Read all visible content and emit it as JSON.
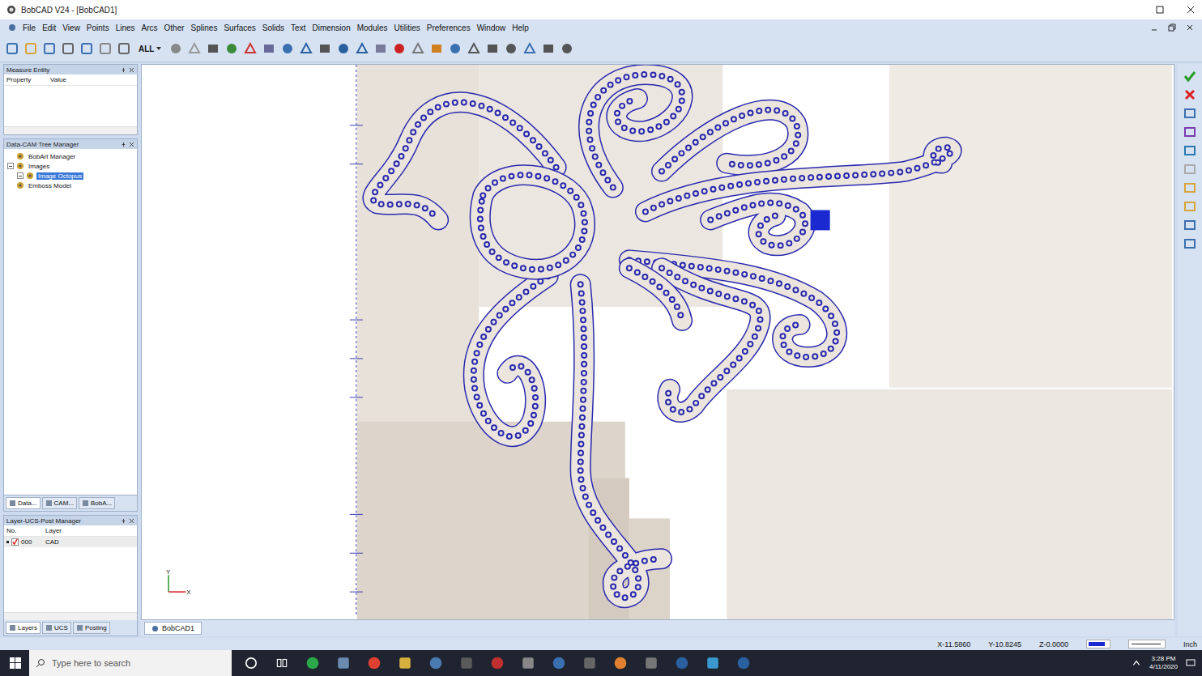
{
  "window": {
    "title": "BobCAD V24 - [BobCAD1]"
  },
  "menu": [
    "File",
    "Edit",
    "View",
    "Points",
    "Lines",
    "Arcs",
    "Other",
    "Splines",
    "Surfaces",
    "Solids",
    "Text",
    "Dimension",
    "Modules",
    "Utilities",
    "Preferences",
    "Window",
    "Help"
  ],
  "toolbar": {
    "filter": "ALL"
  },
  "measure_panel": {
    "title": "Measure Entity",
    "columns": [
      "Property",
      "Value"
    ]
  },
  "tree_panel": {
    "title": "Data-CAM Tree Manager",
    "items": [
      {
        "label": "BobArt Manager",
        "depth": 0,
        "selected": false,
        "expandable": false,
        "expanded": false
      },
      {
        "label": "Images",
        "depth": 0,
        "selected": false,
        "expandable": true,
        "expanded": true
      },
      {
        "label": "Image Octopus",
        "depth": 1,
        "selected": true,
        "expandable": true,
        "expanded": false
      },
      {
        "label": "Emboss Model",
        "depth": 0,
        "selected": false,
        "expandable": false,
        "expanded": false
      }
    ],
    "tabs": [
      {
        "label": "Data...",
        "selected": true
      },
      {
        "label": "CAM...",
        "selected": false
      },
      {
        "label": "BobA...",
        "selected": false
      }
    ]
  },
  "layer_panel": {
    "title": "Layer-UCS-Post Manager",
    "columns": [
      "No.",
      "Layer"
    ],
    "rows": [
      {
        "no": "000",
        "layer": "CAD",
        "checked": true
      }
    ],
    "tabs": [
      {
        "label": "Layers",
        "selected": true
      },
      {
        "label": "UCS",
        "selected": false
      },
      {
        "label": "Posting",
        "selected": false
      }
    ]
  },
  "axis": {
    "x": "X",
    "y": "Y"
  },
  "document_tabs": [
    {
      "label": "BobCAD1",
      "selected": true
    }
  ],
  "status_bar": {
    "x": "X-11.5860",
    "y": "Y-10.8245",
    "z": "Z-0.0000",
    "units": "Inch"
  },
  "taskbar": {
    "search_placeholder": "Type here to search",
    "time": "3:28 PM",
    "date": "4/11/2020"
  }
}
